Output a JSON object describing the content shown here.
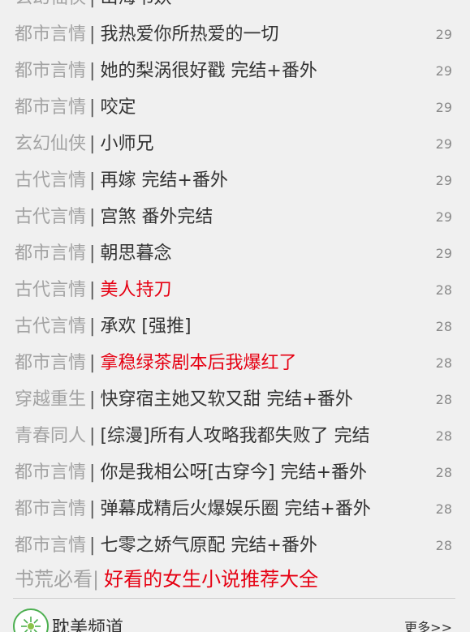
{
  "list": {
    "partial_top_row": {
      "category": "玄幻仙侠",
      "separator": "|",
      "title": "山海书妖"
    },
    "rows": [
      {
        "category": "都市言情",
        "separator": "|",
        "title": "我热爱你所热爱的一切",
        "count": "29",
        "highlight": false
      },
      {
        "category": "都市言情",
        "separator": "|",
        "title": "她的梨涡很好戳 完结+番外",
        "count": "29",
        "highlight": false
      },
      {
        "category": "都市言情",
        "separator": "|",
        "title": "咬定",
        "count": "29",
        "highlight": false
      },
      {
        "category": "玄幻仙侠",
        "separator": "|",
        "title": "小师兄",
        "count": "29",
        "highlight": false
      },
      {
        "category": "古代言情",
        "separator": "|",
        "title": "再嫁 完结+番外",
        "count": "29",
        "highlight": false
      },
      {
        "category": "古代言情",
        "separator": "|",
        "title": "宫煞 番外完结",
        "count": "29",
        "highlight": false
      },
      {
        "category": "都市言情",
        "separator": "|",
        "title": "朝思暮念",
        "count": "29",
        "highlight": false
      },
      {
        "category": "古代言情",
        "separator": "|",
        "title": "美人持刀",
        "count": "28",
        "highlight": true
      },
      {
        "category": "古代言情",
        "separator": "|",
        "title": "承欢 [强推]",
        "count": "28",
        "highlight": false
      },
      {
        "category": "都市言情",
        "separator": "|",
        "title": "拿稳绿茶剧本后我爆红了",
        "count": "28",
        "highlight": true
      },
      {
        "category": "穿越重生",
        "separator": "|",
        "title": "快穿宿主她又软又甜 完结+番外",
        "count": "28",
        "highlight": false
      },
      {
        "category": "青春同人",
        "separator": "|",
        "title": "[综漫]所有人攻略我都失败了 完结",
        "count": "28",
        "highlight": false
      },
      {
        "category": "都市言情",
        "separator": "|",
        "title": "你是我相公呀[古穿今] 完结+番外",
        "count": "28",
        "highlight": false
      },
      {
        "category": "都市言情",
        "separator": "|",
        "title": "弹幕成精后火爆娱乐圈 完结+番外",
        "count": "28",
        "highlight": false
      },
      {
        "category": "都市言情",
        "separator": "|",
        "title": "七零之娇气原配 完结+番外",
        "count": "28",
        "highlight": false
      }
    ]
  },
  "promo": {
    "category": "书荒必看",
    "separator": "|",
    "title": "好看的女生小说推荐大全"
  },
  "channel": {
    "icon": "flower-logo-icon",
    "title": "耽美频道",
    "more_label": "更多>>"
  },
  "colors": {
    "category": "#a3a3a3",
    "title": "#333333",
    "highlight": "#e60012",
    "background": "#f0f0f0"
  }
}
